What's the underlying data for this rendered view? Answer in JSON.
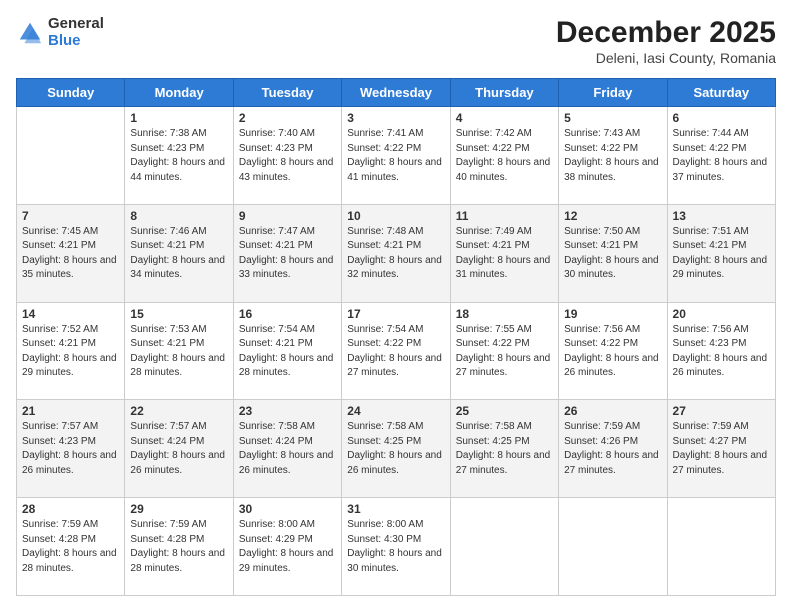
{
  "logo": {
    "general": "General",
    "blue": "Blue"
  },
  "header": {
    "month": "December 2025",
    "location": "Deleni, Iasi County, Romania"
  },
  "weekdays": [
    "Sunday",
    "Monday",
    "Tuesday",
    "Wednesday",
    "Thursday",
    "Friday",
    "Saturday"
  ],
  "weeks": [
    [
      {
        "day": "",
        "sunrise": "",
        "sunset": "",
        "daylight": ""
      },
      {
        "day": "1",
        "sunrise": "Sunrise: 7:38 AM",
        "sunset": "Sunset: 4:23 PM",
        "daylight": "Daylight: 8 hours and 44 minutes."
      },
      {
        "day": "2",
        "sunrise": "Sunrise: 7:40 AM",
        "sunset": "Sunset: 4:23 PM",
        "daylight": "Daylight: 8 hours and 43 minutes."
      },
      {
        "day": "3",
        "sunrise": "Sunrise: 7:41 AM",
        "sunset": "Sunset: 4:22 PM",
        "daylight": "Daylight: 8 hours and 41 minutes."
      },
      {
        "day": "4",
        "sunrise": "Sunrise: 7:42 AM",
        "sunset": "Sunset: 4:22 PM",
        "daylight": "Daylight: 8 hours and 40 minutes."
      },
      {
        "day": "5",
        "sunrise": "Sunrise: 7:43 AM",
        "sunset": "Sunset: 4:22 PM",
        "daylight": "Daylight: 8 hours and 38 minutes."
      },
      {
        "day": "6",
        "sunrise": "Sunrise: 7:44 AM",
        "sunset": "Sunset: 4:22 PM",
        "daylight": "Daylight: 8 hours and 37 minutes."
      }
    ],
    [
      {
        "day": "7",
        "sunrise": "Sunrise: 7:45 AM",
        "sunset": "Sunset: 4:21 PM",
        "daylight": "Daylight: 8 hours and 35 minutes."
      },
      {
        "day": "8",
        "sunrise": "Sunrise: 7:46 AM",
        "sunset": "Sunset: 4:21 PM",
        "daylight": "Daylight: 8 hours and 34 minutes."
      },
      {
        "day": "9",
        "sunrise": "Sunrise: 7:47 AM",
        "sunset": "Sunset: 4:21 PM",
        "daylight": "Daylight: 8 hours and 33 minutes."
      },
      {
        "day": "10",
        "sunrise": "Sunrise: 7:48 AM",
        "sunset": "Sunset: 4:21 PM",
        "daylight": "Daylight: 8 hours and 32 minutes."
      },
      {
        "day": "11",
        "sunrise": "Sunrise: 7:49 AM",
        "sunset": "Sunset: 4:21 PM",
        "daylight": "Daylight: 8 hours and 31 minutes."
      },
      {
        "day": "12",
        "sunrise": "Sunrise: 7:50 AM",
        "sunset": "Sunset: 4:21 PM",
        "daylight": "Daylight: 8 hours and 30 minutes."
      },
      {
        "day": "13",
        "sunrise": "Sunrise: 7:51 AM",
        "sunset": "Sunset: 4:21 PM",
        "daylight": "Daylight: 8 hours and 29 minutes."
      }
    ],
    [
      {
        "day": "14",
        "sunrise": "Sunrise: 7:52 AM",
        "sunset": "Sunset: 4:21 PM",
        "daylight": "Daylight: 8 hours and 29 minutes."
      },
      {
        "day": "15",
        "sunrise": "Sunrise: 7:53 AM",
        "sunset": "Sunset: 4:21 PM",
        "daylight": "Daylight: 8 hours and 28 minutes."
      },
      {
        "day": "16",
        "sunrise": "Sunrise: 7:54 AM",
        "sunset": "Sunset: 4:21 PM",
        "daylight": "Daylight: 8 hours and 28 minutes."
      },
      {
        "day": "17",
        "sunrise": "Sunrise: 7:54 AM",
        "sunset": "Sunset: 4:22 PM",
        "daylight": "Daylight: 8 hours and 27 minutes."
      },
      {
        "day": "18",
        "sunrise": "Sunrise: 7:55 AM",
        "sunset": "Sunset: 4:22 PM",
        "daylight": "Daylight: 8 hours and 27 minutes."
      },
      {
        "day": "19",
        "sunrise": "Sunrise: 7:56 AM",
        "sunset": "Sunset: 4:22 PM",
        "daylight": "Daylight: 8 hours and 26 minutes."
      },
      {
        "day": "20",
        "sunrise": "Sunrise: 7:56 AM",
        "sunset": "Sunset: 4:23 PM",
        "daylight": "Daylight: 8 hours and 26 minutes."
      }
    ],
    [
      {
        "day": "21",
        "sunrise": "Sunrise: 7:57 AM",
        "sunset": "Sunset: 4:23 PM",
        "daylight": "Daylight: 8 hours and 26 minutes."
      },
      {
        "day": "22",
        "sunrise": "Sunrise: 7:57 AM",
        "sunset": "Sunset: 4:24 PM",
        "daylight": "Daylight: 8 hours and 26 minutes."
      },
      {
        "day": "23",
        "sunrise": "Sunrise: 7:58 AM",
        "sunset": "Sunset: 4:24 PM",
        "daylight": "Daylight: 8 hours and 26 minutes."
      },
      {
        "day": "24",
        "sunrise": "Sunrise: 7:58 AM",
        "sunset": "Sunset: 4:25 PM",
        "daylight": "Daylight: 8 hours and 26 minutes."
      },
      {
        "day": "25",
        "sunrise": "Sunrise: 7:58 AM",
        "sunset": "Sunset: 4:25 PM",
        "daylight": "Daylight: 8 hours and 27 minutes."
      },
      {
        "day": "26",
        "sunrise": "Sunrise: 7:59 AM",
        "sunset": "Sunset: 4:26 PM",
        "daylight": "Daylight: 8 hours and 27 minutes."
      },
      {
        "day": "27",
        "sunrise": "Sunrise: 7:59 AM",
        "sunset": "Sunset: 4:27 PM",
        "daylight": "Daylight: 8 hours and 27 minutes."
      }
    ],
    [
      {
        "day": "28",
        "sunrise": "Sunrise: 7:59 AM",
        "sunset": "Sunset: 4:28 PM",
        "daylight": "Daylight: 8 hours and 28 minutes."
      },
      {
        "day": "29",
        "sunrise": "Sunrise: 7:59 AM",
        "sunset": "Sunset: 4:28 PM",
        "daylight": "Daylight: 8 hours and 28 minutes."
      },
      {
        "day": "30",
        "sunrise": "Sunrise: 8:00 AM",
        "sunset": "Sunset: 4:29 PM",
        "daylight": "Daylight: 8 hours and 29 minutes."
      },
      {
        "day": "31",
        "sunrise": "Sunrise: 8:00 AM",
        "sunset": "Sunset: 4:30 PM",
        "daylight": "Daylight: 8 hours and 30 minutes."
      },
      {
        "day": "",
        "sunrise": "",
        "sunset": "",
        "daylight": ""
      },
      {
        "day": "",
        "sunrise": "",
        "sunset": "",
        "daylight": ""
      },
      {
        "day": "",
        "sunrise": "",
        "sunset": "",
        "daylight": ""
      }
    ]
  ]
}
